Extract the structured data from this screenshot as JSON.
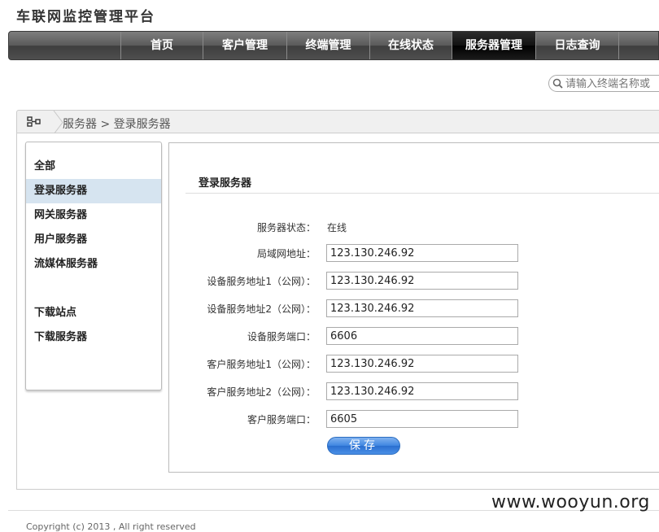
{
  "header": {
    "title": "车联网监控管理平台"
  },
  "nav": {
    "items": [
      {
        "label": "首页"
      },
      {
        "label": "客户管理"
      },
      {
        "label": "终端管理"
      },
      {
        "label": "在线状态"
      },
      {
        "label": "服务器管理"
      },
      {
        "label": "日志查询"
      }
    ],
    "active": "服务器管理"
  },
  "search": {
    "placeholder": "请输入终端名称或"
  },
  "breadcrumb": {
    "text": "服务器 > 登录服务器"
  },
  "sidebar": {
    "items": [
      {
        "label": "全部"
      },
      {
        "label": "登录服务器"
      },
      {
        "label": "网关服务器"
      },
      {
        "label": "用户服务器"
      },
      {
        "label": "流媒体服务器"
      },
      {
        "label": "下载站点"
      },
      {
        "label": "下载服务器"
      }
    ],
    "active": "登录服务器"
  },
  "panel": {
    "title": "登录服务器",
    "status_label": "服务器状态：",
    "status_value": "在线",
    "fields": [
      {
        "label": "局域网地址：",
        "value": "123.130.246.92"
      },
      {
        "label": "设备服务地址1（公网）：",
        "value": "123.130.246.92"
      },
      {
        "label": "设备服务地址2（公网）：",
        "value": "123.130.246.92"
      },
      {
        "label": "设备服务端口：",
        "value": "6606"
      },
      {
        "label": "客户服务地址1（公网）：",
        "value": "123.130.246.92"
      },
      {
        "label": "客户服务地址2（公网）：",
        "value": "123.130.246.92"
      },
      {
        "label": "客户服务端口：",
        "value": "6605"
      }
    ],
    "save_label": "保存"
  },
  "footer": {
    "copyright": "Copyright (c) 2013 , All right reserved"
  },
  "watermark": "www.wooyun.org",
  "colors": {
    "nav_bg": "#4e4e4e",
    "nav_active": "#111111",
    "sidebar_active": "#d6e4f0",
    "button": "#3f86e0"
  }
}
